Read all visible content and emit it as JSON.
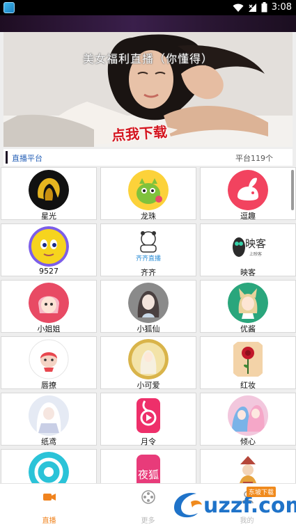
{
  "status_bar": {
    "time": "3:08"
  },
  "banner": {
    "title": "美女福利直播（你懂得）",
    "cta": "点我下载"
  },
  "section": {
    "title": "直播平台",
    "count": "平台119个"
  },
  "platforms": [
    {
      "label": "星光",
      "icon": "golden-hair-logo-icon"
    },
    {
      "label": "龙珠",
      "icon": "green-dragon-icon"
    },
    {
      "label": "逗趣",
      "icon": "pink-bunny-icon"
    },
    {
      "label": "9527",
      "icon": "yellow-face-icon"
    },
    {
      "label": "齐齐",
      "icon": "bear-logo-icon"
    },
    {
      "label": "映客",
      "icon": "owl-logo-icon"
    },
    {
      "label": "小姐姐",
      "icon": "anime-girl-pink-icon"
    },
    {
      "label": "小狐仙",
      "icon": "anime-girl-sketch-icon"
    },
    {
      "label": "优酱",
      "icon": "anime-fox-girl-icon"
    },
    {
      "label": "唇撩",
      "icon": "cartoon-girl-icon"
    },
    {
      "label": "小可爱",
      "icon": "coin-girl-icon"
    },
    {
      "label": "红妆",
      "icon": "red-rose-icon"
    },
    {
      "label": "纸鸢",
      "icon": "white-hair-girl-icon"
    },
    {
      "label": "月令",
      "icon": "pink-play-icon"
    },
    {
      "label": "倾心",
      "icon": "anime-duo-icon"
    },
    {
      "label": "",
      "icon": "cyan-camera-icon"
    },
    {
      "label": "",
      "icon": "night-fox-icon"
    },
    {
      "label": "",
      "icon": "cartoon-character-icon"
    }
  ],
  "nav": [
    {
      "label": "直播",
      "icon": "video-camera-icon",
      "active": true
    },
    {
      "label": "更多",
      "icon": "film-reel-icon",
      "active": false
    },
    {
      "label": "我的",
      "icon": "user-icon",
      "active": false
    }
  ],
  "watermark": {
    "text": "uzzf.com",
    "badge": "东坡下载"
  },
  "colors": {
    "accent": "#f0831e",
    "section_title": "#2a63b8",
    "cta": "#d4151f"
  }
}
